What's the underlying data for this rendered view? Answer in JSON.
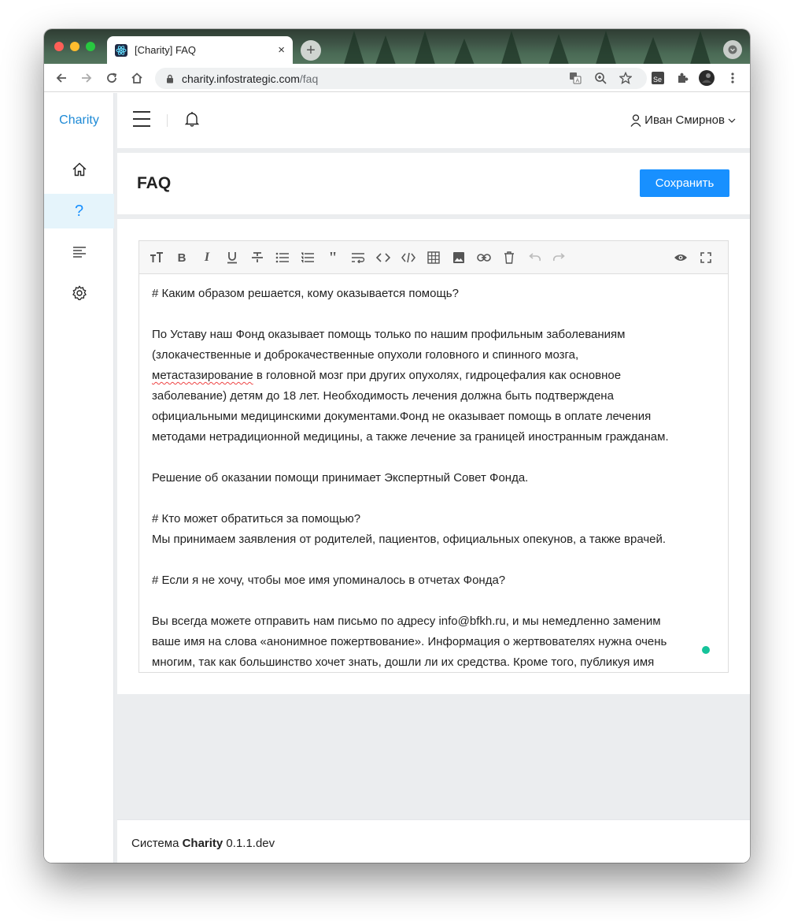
{
  "browser": {
    "tab_title": "[Charity] FAQ",
    "tab_close": "×",
    "new_tab": "+",
    "url_host": "charity.infostrategic.com",
    "url_path": "/faq"
  },
  "sidebar": {
    "brand": "Charity",
    "items": [
      {
        "name": "home",
        "icon": "home-icon"
      },
      {
        "name": "faq",
        "icon": "question-icon",
        "glyph": "?",
        "active": true
      },
      {
        "name": "list",
        "icon": "align-left-icon"
      },
      {
        "name": "settings",
        "icon": "gear-icon"
      }
    ]
  },
  "header": {
    "user_name": "Иван Смирнов"
  },
  "page": {
    "title": "FAQ",
    "save_label": "Сохранить"
  },
  "editor": {
    "toolbar": [
      "text-size",
      "bold",
      "italic",
      "underline",
      "strikethrough",
      "bullet-list",
      "ordered-list",
      "quote",
      "wrap",
      "code",
      "code-block",
      "table",
      "image",
      "link",
      "delete",
      "undo",
      "redo",
      "preview",
      "fullscreen"
    ],
    "lines": [
      "# Каким образом решается, кому оказывается помощь?",
      "",
      "По Уставу наш Фонд оказывает помощь только по нашим профильным заболеваниям",
      "(злокачественные  и доброкачественные опухоли головного и спинного мозга,",
      "метастазирование",
      " в головной мозг при других опухолях, гидроцефалия как основное",
      "заболевание) детям до 18 лет. Необходимость лечения должна быть подтверждена",
      "официальными медицинскими документами.Фонд не оказывает помощь в оплате лечения",
      "методами нетрадиционной медицины, а также лечение за границей иностранным гражданам.",
      "",
      "Решение об оказании помощи принимает Экспертный Совет Фонда.",
      "",
      "# Кто может обратиться за помощью?",
      "Мы принимаем заявления от родителей, пациентов, официальных опекунов, а также врачей.",
      "",
      "# Если я не хочу, чтобы мое имя упоминалось в отчетах Фонда?",
      "",
      "Вы всегда можете отправить нам письмо по адресу info@bfkh.ru, и мы немедленно заменим",
      "ваше имя на слова «анонимное пожертвование». Информация о жертвователях нужна очень",
      "многим, так как большинство хочет знать, дошли ли их средства. Кроме того, публикуя имя"
    ]
  },
  "footer": {
    "prefix": "Система ",
    "app": "Charity",
    "version": " 0.1.1.dev"
  }
}
